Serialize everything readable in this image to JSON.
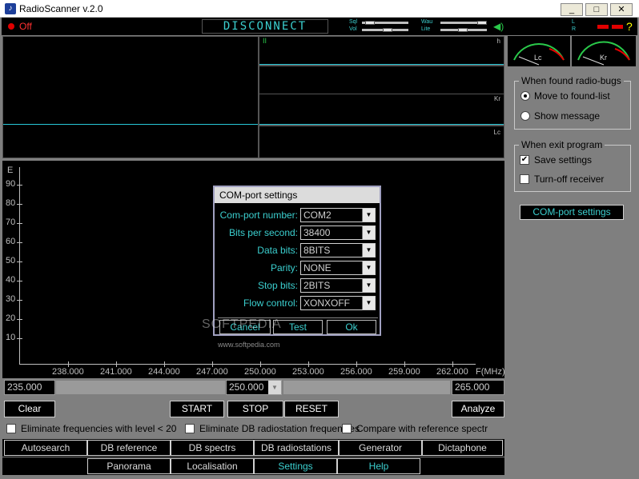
{
  "window": {
    "title": "RadioScanner v.2.0",
    "buttons": {
      "minimize": "_",
      "maximize": "□",
      "close": "✕"
    }
  },
  "status": {
    "power_label": "Off",
    "connection": "DISCONNECT",
    "sql_label": "Sql",
    "vol_label": "Vol",
    "wau_label": "Wau",
    "lite_label": "Lite",
    "l_label": "L",
    "r_label": "R",
    "help": "?"
  },
  "scopes": {
    "tr_top_label": "h",
    "tr_mid_label": "Kr",
    "tr_bot_label": "Lc",
    "marker_label": "II"
  },
  "meters": {
    "left_label": "Lc",
    "right_label": "Kr"
  },
  "side": {
    "found_group_title": "When found radio-bugs",
    "found_options": [
      "Move to found-list",
      "Show message"
    ],
    "exit_group_title": "When exit program",
    "exit_options": [
      "Save settings",
      "Turn-off receiver"
    ],
    "com_button": "COM-port settings"
  },
  "spectrum": {
    "y_unit": "E",
    "y_ticks": [
      "90",
      "80",
      "70",
      "60",
      "50",
      "40",
      "30",
      "20",
      "10"
    ],
    "x_ticks": [
      "238.000",
      "241.000",
      "244.000",
      "247.000",
      "250.000",
      "253.000",
      "256.000",
      "259.000",
      "262.000"
    ],
    "x_unit": "F(MHz)"
  },
  "range": {
    "start": "235.000",
    "center": "250.000",
    "end": "265.000"
  },
  "controls": {
    "clear": "Clear",
    "start": "START",
    "stop": "STOP",
    "reset": "RESET",
    "analyze": "Analyze"
  },
  "filters": {
    "level": "Eliminate frequencies with level < 20",
    "db_radio": "Eliminate DB radiostation frequencies",
    "compare": "Compare with reference spectr"
  },
  "tabs_row1": [
    "Autosearch",
    "DB reference spectrs",
    "DB spectrs",
    "DB radiostations",
    "Generator",
    "Dictaphone"
  ],
  "tabs_row2": [
    "Panorama",
    "Localisation",
    "Settings",
    "Help"
  ],
  "dialog": {
    "title": "COM-port settings",
    "rows": [
      {
        "label": "Com-port number:",
        "value": "COM2"
      },
      {
        "label": "Bits per second:",
        "value": "38400"
      },
      {
        "label": "Data bits:",
        "value": "8BITS"
      },
      {
        "label": "Parity:",
        "value": "NONE"
      },
      {
        "label": "Stop bits:",
        "value": "2BITS"
      },
      {
        "label": "Flow control:",
        "value": "XONXOFF"
      }
    ],
    "cancel": "Cancel",
    "test": "Test",
    "ok": "Ok"
  },
  "watermark": {
    "brand": "SOFTPEDIA",
    "url": "www.softpedia.com"
  },
  "colors": {
    "accent_cyan": "#3bcfcf",
    "alert_red": "#e00000",
    "panel_grey": "#7f7f7f"
  }
}
